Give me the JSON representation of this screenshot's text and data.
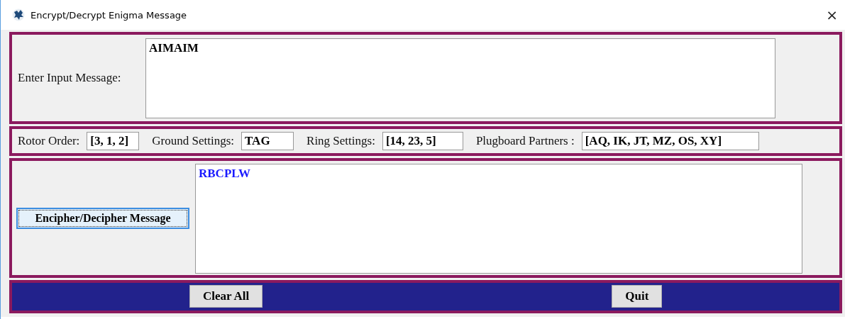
{
  "window": {
    "title": "Encrypt/Decrypt Enigma Message",
    "close": "×"
  },
  "input": {
    "label": "Enter Input Message:",
    "value": "AIMAIM"
  },
  "settings": [
    {
      "label": "Rotor Order:",
      "value": "[3, 1, 2]"
    },
    {
      "label": "Ground Settings:",
      "value": "TAG"
    },
    {
      "label": "Ring Settings:",
      "value": "[14, 23, 5]"
    },
    {
      "label": "Plugboard Partners :",
      "value": "[AQ, IK, JT, MZ, OS, XY]"
    }
  ],
  "action": {
    "label": "Encipher/Decipher Message",
    "focused": true
  },
  "output": {
    "value": "RBCPLW"
  },
  "buttons": [
    {
      "label": "Clear All"
    },
    {
      "label": "Quit"
    }
  ]
}
